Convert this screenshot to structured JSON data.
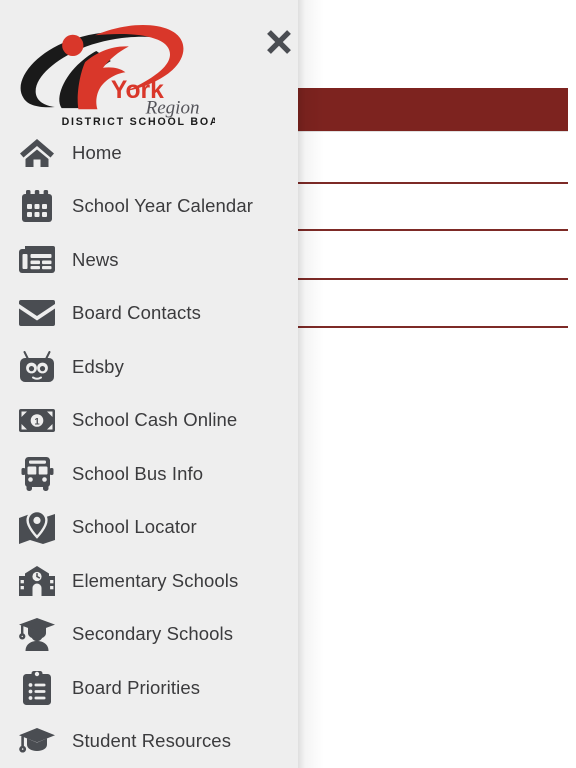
{
  "logo": {
    "brand_primary": "York",
    "brand_secondary": "Region",
    "brand_tagline": "DISTRICT SCHOOL BOARD",
    "color_red": "#d9372a",
    "color_black": "#1a1a1a",
    "color_gray": "#54545a"
  },
  "drawer": {
    "background": "#eeeeee",
    "close_label": "✕"
  },
  "background_page": {
    "banner_color": "#7d231f",
    "rule_color": "#7d2a26"
  },
  "menu": {
    "items": [
      {
        "label": "Home",
        "icon": "home-icon"
      },
      {
        "label": "School Year Calendar",
        "icon": "calendar-icon"
      },
      {
        "label": "News",
        "icon": "newspaper-icon"
      },
      {
        "label": "Board Contacts",
        "icon": "envelope-icon"
      },
      {
        "label": "Edsby",
        "icon": "robot-icon"
      },
      {
        "label": "School Cash Online",
        "icon": "banknote-icon"
      },
      {
        "label": "School Bus Info",
        "icon": "bus-icon"
      },
      {
        "label": "School Locator",
        "icon": "map-pin-icon"
      },
      {
        "label": "Elementary Schools",
        "icon": "school-building-icon"
      },
      {
        "label": "Secondary Schools",
        "icon": "graduate-icon"
      },
      {
        "label": "Board Priorities",
        "icon": "clipboard-icon"
      },
      {
        "label": "Student Resources",
        "icon": "graduation-cap-icon"
      }
    ]
  }
}
